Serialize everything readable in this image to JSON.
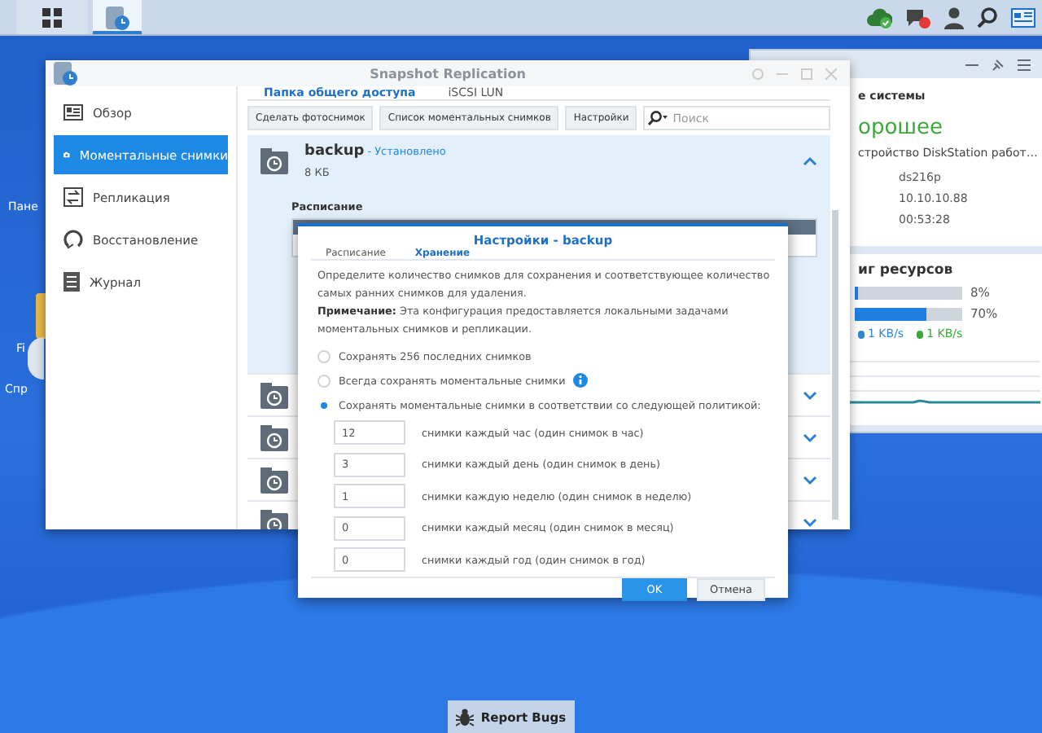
{
  "taskbar": {
    "apps": [
      {
        "kind": "menu",
        "selected": false
      },
      {
        "kind": "snapshot",
        "selected": true
      }
    ]
  },
  "desktop_icons": [
    {
      "kind": "panel",
      "label": "Пане"
    },
    {
      "kind": "folder",
      "label": "Fi"
    },
    {
      "kind": "help",
      "label": "Спр"
    }
  ],
  "main_window": {
    "title": "Snapshot Replication",
    "sidebar": [
      {
        "kind": "overview",
        "label": "Обзор",
        "selected": false
      },
      {
        "kind": "snapshots",
        "label": "Моментальные снимки",
        "selected": true
      },
      {
        "kind": "replication",
        "label": "Репликация",
        "selected": false
      },
      {
        "kind": "recovery",
        "label": "Восстановление",
        "selected": false
      },
      {
        "kind": "log",
        "label": "Журнал",
        "selected": false
      }
    ],
    "tabs": [
      {
        "label": "Папка общего доступа",
        "selected": true
      },
      {
        "label": "iSCSI LUN",
        "selected": false
      }
    ],
    "toolbar": [
      "Сделать фотоснимок",
      "Список моментальных снимков",
      "Настройки"
    ],
    "search": {
      "placeholder": "Поиск"
    },
    "list": [
      {
        "name": "backup",
        "status": "- Установлено",
        "size": "8 КБ",
        "expanded": true,
        "schedule_label": "Расписание"
      },
      {
        "expanded": false
      },
      {
        "expanded": false
      },
      {
        "expanded": false
      },
      {
        "expanded": false
      }
    ]
  },
  "widget": {
    "system_heading": "е системы",
    "status": "орошее",
    "description": "стройство DiskStation работ…",
    "values": [
      "ds216p",
      "10.10.10.88",
      "00:53:28"
    ],
    "resource_heading": "иг ресурсов",
    "meters": [
      {
        "level": 0.03,
        "reading": "8%"
      },
      {
        "level": 0.67,
        "reading": "70%"
      }
    ],
    "rates": [
      {
        "text": "1 KB/s",
        "color": "#2f86d8"
      },
      {
        "text": "1 KB/s",
        "color": "#3aa93a"
      }
    ]
  },
  "dialog": {
    "title": "Настройки - backup",
    "tabs": [
      {
        "label": "Расписание",
        "selected": false
      },
      {
        "label": "Хранение",
        "selected": true
      }
    ],
    "description": "Определите количество снимков для сохранения и соответствующее количество самых ранних снимков для удаления.",
    "note": "**Примечание:** Эта конфигурация предоставляется локальными задачами моментальных снимков и репликации.",
    "options": [
      {
        "label": "Сохранять 256 последних снимков",
        "selected": false,
        "info": false
      },
      {
        "label": "Всегда сохранять моментальные снимки",
        "selected": false,
        "info": true
      },
      {
        "label": "Сохранять моментальные снимки в соответствии со следующей политикой:",
        "selected": true,
        "info": false
      }
    ],
    "policy": [
      {
        "value": "12",
        "label": "снимки каждый час (один снимок в час)"
      },
      {
        "value": "3",
        "label": "снимки каждый день (один снимок в день)"
      },
      {
        "value": "1",
        "label": "снимки каждую неделю (один снимок в неделю)"
      },
      {
        "value": "0",
        "label": "снимки каждый месяц (один снимок в месяц)"
      },
      {
        "value": "0",
        "label": "снимки каждый год (один снимок в год)"
      }
    ],
    "buttons": [
      {
        "label": "OK",
        "kind": "primary"
      },
      {
        "label": "Отмена",
        "kind": "secondary"
      }
    ]
  },
  "report_bugs": {
    "label": "Report Bugs"
  }
}
